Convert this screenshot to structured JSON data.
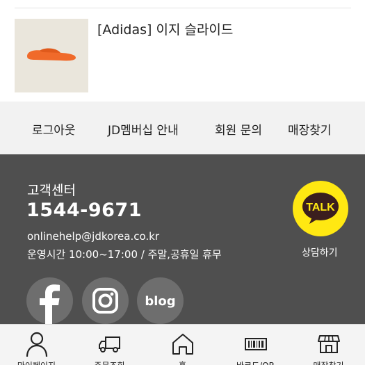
{
  "product": {
    "name": "[Adidas] 이지 슬라이드",
    "image_icon": "orange-slide-sandal-image"
  },
  "links": [
    {
      "label": "로그아웃"
    },
    {
      "label": "JD멤버십 안내"
    },
    {
      "label": "회원 문의"
    },
    {
      "label": "매장찾기"
    }
  ],
  "footer": {
    "cs_title": "고객센터",
    "phone": "1544-9671",
    "email": "onlinehelp@jdkorea.co.kr",
    "hours": "운영시간 10:00~17:00 / 주말,공휴일 휴무",
    "kakao_talk_text": "TALK",
    "kakao_label": "상담하기",
    "social": [
      {
        "icon": "facebook-icon"
      },
      {
        "icon": "instagram-icon"
      },
      {
        "icon": "blog-icon",
        "text": "blog"
      }
    ],
    "colors": {
      "footer_bg": "#4f4f4f",
      "kakao_yellow": "#ffe812"
    }
  },
  "tabbar": {
    "tabs": [
      {
        "label": "마이페이지",
        "icon": "person-icon"
      },
      {
        "label": "주문조회",
        "icon": "truck-icon"
      },
      {
        "label": "홈",
        "icon": "home-icon"
      },
      {
        "label": "바코드/QR",
        "icon": "barcode-icon"
      },
      {
        "label": "매장찾기",
        "icon": "store-icon"
      }
    ]
  }
}
